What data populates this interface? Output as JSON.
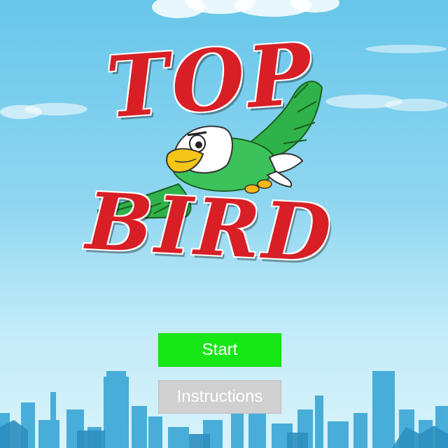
{
  "game": {
    "title_line1": "TOP",
    "title_line2": "BIRD"
  },
  "menu": {
    "start_label": "Start",
    "instructions_label": "Instructions"
  },
  "colors": {
    "title_red": "#d81f26",
    "start_button": "#17e815",
    "instructions_button": "#d0d0d0",
    "sky": "#7ccfee",
    "skyline": "#2f9fd0"
  },
  "icons": [
    "eagle-icon",
    "cloud-icon",
    "city-skyline"
  ]
}
